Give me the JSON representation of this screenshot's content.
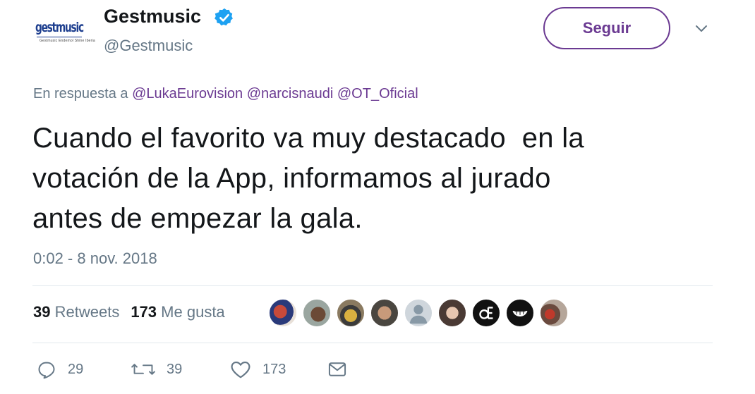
{
  "user": {
    "display_name": "Gestmusic",
    "handle": "@Gestmusic",
    "logo_text": "gestmusic",
    "logo_subtext": "Gestmusic Endemol Shine Iberia"
  },
  "header": {
    "follow_label": "Seguir"
  },
  "reply": {
    "prefix": "En respuesta a",
    "mentions": [
      "@LukaEurovision",
      "@narcisnaudi",
      "@OT_Oficial"
    ]
  },
  "tweet": {
    "lines": [
      "Cuando el favorito va muy destacado  en la",
      "votación de la App, informamos al jurado",
      "antes de empezar la gala."
    ],
    "timestamp": "0:02 - 8 nov. 2018"
  },
  "stats": {
    "retweets_count": "39",
    "retweets_label": "Retweets",
    "likes_count": "173",
    "likes_label": "Me gusta"
  },
  "actions": {
    "reply_count": "29",
    "retweet_count": "39",
    "like_count": "173"
  },
  "colors": {
    "accent": "#6b3a92",
    "verified": "#1da1f2",
    "muted": "#657786",
    "text": "#14171a"
  }
}
